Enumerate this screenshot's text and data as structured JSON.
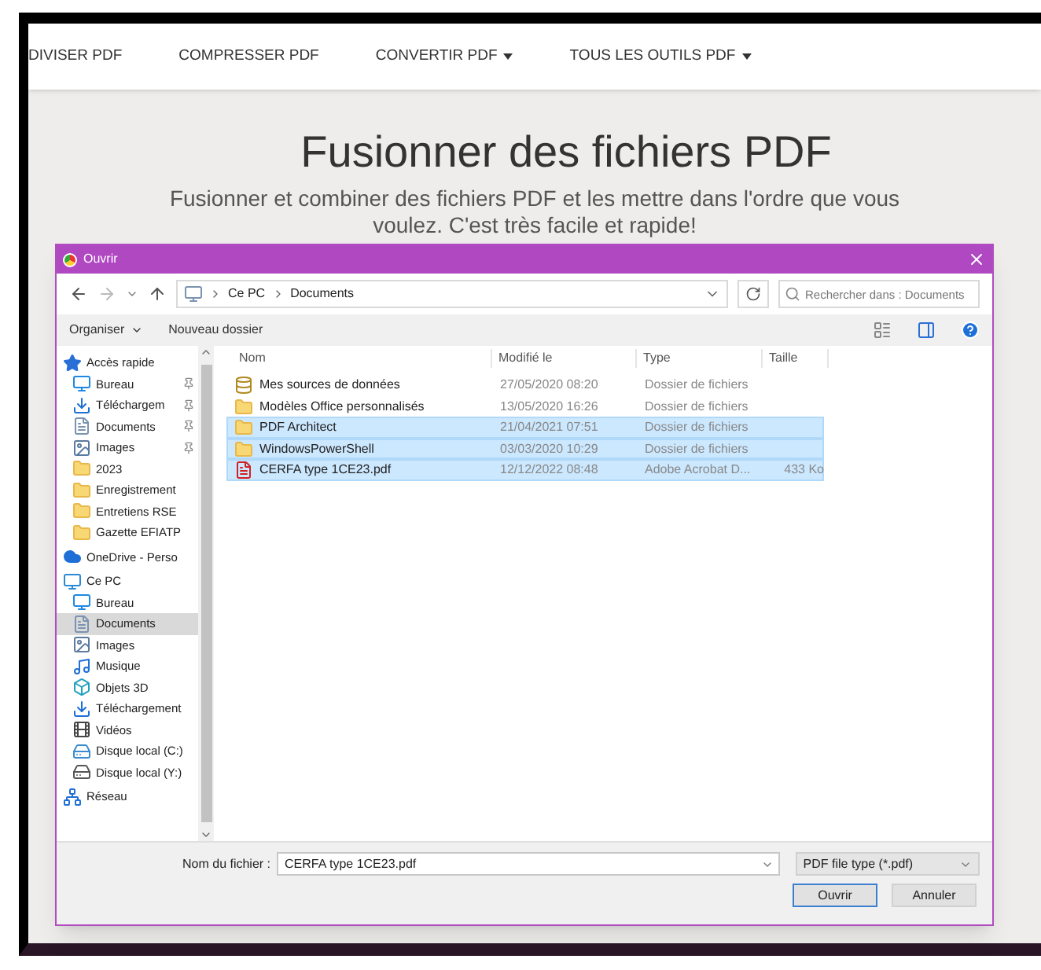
{
  "nav": [
    {
      "label": "DIVISER PDF"
    },
    {
      "label": "COMPRESSER PDF"
    },
    {
      "label": "CONVERTIR PDF",
      "dropdown": true
    },
    {
      "label": "TOUS LES OUTILS PDF",
      "dropdown": true
    }
  ],
  "hero": {
    "title": "Fusionner des fichiers PDF",
    "subtitle": "Fusionner et combiner des fichiers PDF et les mettre dans l'ordre que vous voulez. C'est très facile et rapide!"
  },
  "dialog": {
    "title": "Ouvrir",
    "breadcrumb": [
      "Ce PC",
      "Documents"
    ],
    "search": {
      "placeholder": "Rechercher dans : Documents"
    },
    "toolbar": {
      "organize": "Organiser",
      "new_folder": "Nouveau dossier"
    },
    "sidebar": [
      {
        "label": "Accès rapide",
        "kind": "star",
        "selected": false,
        "children": [
          {
            "label": "Bureau",
            "kind": "desktop",
            "selected": false,
            "pinned": true
          },
          {
            "label": "Téléchargem",
            "kind": "download",
            "selected": false,
            "pinned": true
          },
          {
            "label": "Documents",
            "kind": "documents",
            "selected": false,
            "pinned": true
          },
          {
            "label": "Images",
            "kind": "pictures",
            "selected": false,
            "pinned": true
          },
          {
            "label": "2023",
            "kind": "folder",
            "selected": false
          },
          {
            "label": "Enregistrement",
            "kind": "folder",
            "selected": false
          },
          {
            "label": "Entretiens RSE",
            "kind": "folder",
            "selected": false
          },
          {
            "label": "Gazette EFIATP",
            "kind": "folder",
            "selected": false
          }
        ]
      },
      {
        "label": "OneDrive - Perso",
        "kind": "cloud",
        "selected": false
      },
      {
        "label": "Ce PC",
        "kind": "pc",
        "selected": false,
        "children": [
          {
            "label": "Bureau",
            "kind": "desktop",
            "selected": false
          },
          {
            "label": "Documents",
            "kind": "documents",
            "selected": true
          },
          {
            "label": "Images",
            "kind": "pictures",
            "selected": false
          },
          {
            "label": "Musique",
            "kind": "music",
            "selected": false
          },
          {
            "label": "Objets 3D",
            "kind": "objects",
            "selected": false
          },
          {
            "label": "Téléchargement",
            "kind": "download",
            "selected": false
          },
          {
            "label": "Vidéos",
            "kind": "videos",
            "selected": false
          },
          {
            "label": "Disque local (C:)",
            "kind": "system-drive",
            "selected": false
          },
          {
            "label": "Disque local (Y:)",
            "kind": "drive",
            "selected": false
          }
        ]
      },
      {
        "label": "Réseau",
        "kind": "network",
        "selected": false
      }
    ],
    "columns": [
      "Nom",
      "Modifié le",
      "Type",
      "Taille"
    ],
    "files": [
      {
        "name": "Mes sources de données",
        "modified": "27/05/2020 08:20",
        "type": "Dossier de fichiers",
        "kind": "data-folder",
        "selected": false
      },
      {
        "name": "Modèles Office personnalisés",
        "modified": "13/05/2020 16:26",
        "type": "Dossier de fichiers",
        "kind": "folder",
        "selected": false
      },
      {
        "name": "PDF Architect",
        "modified": "21/04/2021 07:51",
        "type": "Dossier de fichiers",
        "kind": "folder",
        "selected": true
      },
      {
        "name": "WindowsPowerShell",
        "modified": "03/03/2020 10:29",
        "type": "Dossier de fichiers",
        "kind": "folder",
        "selected": true
      },
      {
        "name": "CERFA type 1CE23.pdf",
        "modified": "12/12/2022 08:48",
        "type": "Adobe Acrobat D...",
        "size": "433 Ko",
        "kind": "pdf",
        "selected": true
      }
    ],
    "filename": {
      "label": "Nom du fichier :",
      "value": "CERFA type 1CE23.pdf"
    },
    "filetype": "PDF file type (*.pdf)",
    "buttons": [
      {
        "label": "Ouvrir",
        "kind": "primary"
      },
      {
        "label": "Annuler",
        "kind": "secondary"
      }
    ]
  }
}
